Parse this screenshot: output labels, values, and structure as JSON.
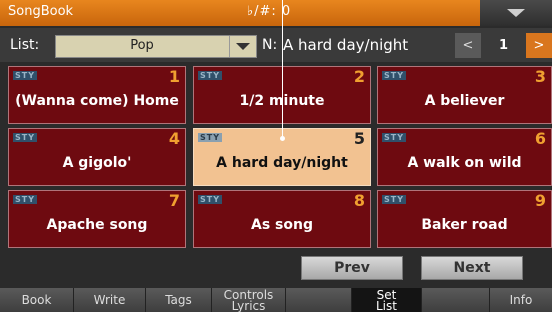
{
  "header": {
    "app_title": "SongBook",
    "transpose": "♭/#: 0",
    "menu_icon": "triangle-down-icon",
    "accent_color": "#d9761e"
  },
  "list": {
    "label": "List:",
    "selected": "Pop",
    "name_label": "N:",
    "name_value": "A hard day/night",
    "page": "1",
    "prev_glyph": "<",
    "next_glyph": ">"
  },
  "entries": [
    {
      "badge": "STY",
      "num": "1",
      "title": "(Wanna come) Home"
    },
    {
      "badge": "STY",
      "num": "2",
      "title": "1/2 minute"
    },
    {
      "badge": "STY",
      "num": "3",
      "title": "A believer"
    },
    {
      "badge": "STY",
      "num": "4",
      "title": "A gigolo'"
    },
    {
      "badge": "STY",
      "num": "5",
      "title": "A hard day/night"
    },
    {
      "badge": "STY",
      "num": "6",
      "title": "A walk on wild"
    },
    {
      "badge": "STY",
      "num": "7",
      "title": "Apache song"
    },
    {
      "badge": "STY",
      "num": "8",
      "title": "As song"
    },
    {
      "badge": "STY",
      "num": "9",
      "title": "Baker road"
    }
  ],
  "selected_index": 4,
  "nav": {
    "prev": "Prev",
    "next": "Next"
  },
  "tabs": [
    {
      "label": "Book"
    },
    {
      "label": "Write"
    },
    {
      "label": "Tags"
    },
    {
      "label1": "Controls",
      "label2": "Lyrics"
    },
    {
      "label": ""
    },
    {
      "label1": "Set",
      "label2": "List"
    },
    {
      "label": ""
    },
    {
      "label": "Info"
    }
  ]
}
